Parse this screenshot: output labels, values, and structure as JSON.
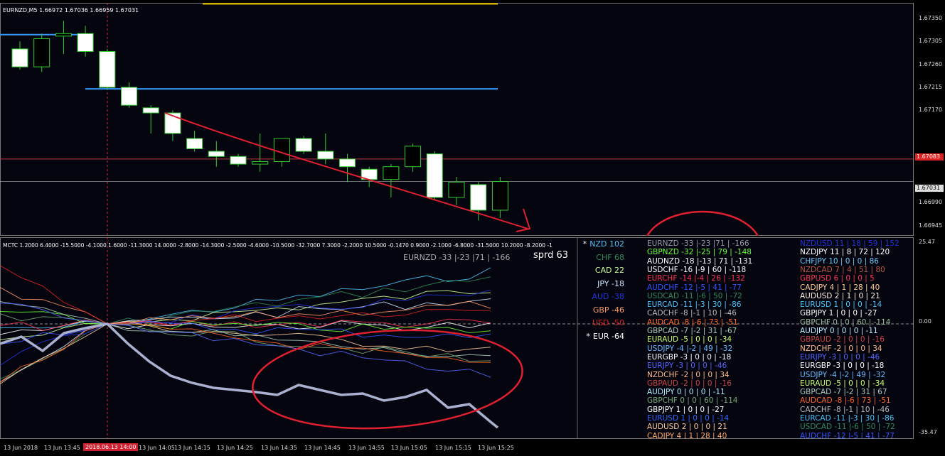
{
  "chart": {
    "title": "EURNZD,M5  1.66972 1.67036 1.66959 1.67031",
    "last_price_tag": "1.67031",
    "red_line_tag": "1.67083",
    "price_axis": [
      "1.67350",
      "1.67305",
      "1.67260",
      "1.67215",
      "1.67170",
      "1.67080",
      "1.66990",
      "1.66945"
    ],
    "candles": [
      {
        "o": 1.6729,
        "h": 1.67305,
        "l": 1.6725,
        "c": 1.67255
      },
      {
        "o": 1.67255,
        "h": 1.6732,
        "l": 1.67245,
        "c": 1.6731
      },
      {
        "o": 1.67315,
        "h": 1.67345,
        "l": 1.6728,
        "c": 1.6732
      },
      {
        "o": 1.6732,
        "h": 1.67335,
        "l": 1.67275,
        "c": 1.67285
      },
      {
        "o": 1.67285,
        "h": 1.6729,
        "l": 1.6721,
        "c": 1.67215
      },
      {
        "o": 1.67215,
        "h": 1.67225,
        "l": 1.67175,
        "c": 1.6718
      },
      {
        "o": 1.67175,
        "h": 1.6718,
        "l": 1.67125,
        "c": 1.67165
      },
      {
        "o": 1.67165,
        "h": 1.6717,
        "l": 1.6711,
        "c": 1.67125
      },
      {
        "o": 1.67115,
        "h": 1.6713,
        "l": 1.6709,
        "c": 1.67095
      },
      {
        "o": 1.6709,
        "h": 1.6711,
        "l": 1.6706,
        "c": 1.6708
      },
      {
        "o": 1.6708,
        "h": 1.67085,
        "l": 1.6706,
        "c": 1.67065
      },
      {
        "o": 1.67065,
        "h": 1.67125,
        "l": 1.6705,
        "c": 1.6707
      },
      {
        "o": 1.6707,
        "h": 1.67115,
        "l": 1.6706,
        "c": 1.67115
      },
      {
        "o": 1.67115,
        "h": 1.6712,
        "l": 1.67085,
        "c": 1.6709
      },
      {
        "o": 1.6709,
        "h": 1.67125,
        "l": 1.67065,
        "c": 1.67075
      },
      {
        "o": 1.67075,
        "h": 1.67085,
        "l": 1.6703,
        "c": 1.6706
      },
      {
        "o": 1.67055,
        "h": 1.6706,
        "l": 1.6702,
        "c": 1.67035
      },
      {
        "o": 1.67035,
        "h": 1.67065,
        "l": 1.67,
        "c": 1.6706
      },
      {
        "o": 1.6706,
        "h": 1.67105,
        "l": 1.6705,
        "c": 1.671
      },
      {
        "o": 1.67085,
        "h": 1.6709,
        "l": 1.66995,
        "c": 1.67
      },
      {
        "o": 1.67,
        "h": 1.6704,
        "l": 1.66985,
        "c": 1.6703
      },
      {
        "o": 1.67025,
        "h": 1.6703,
        "l": 1.66955,
        "c": 1.66975
      },
      {
        "o": 1.66975,
        "h": 1.6704,
        "l": 1.6696,
        "c": 1.67031
      }
    ]
  },
  "indicator": {
    "title": "MCTC  1.2000 6.4000 -15.5000 -4.1000 1.6000 -11.3000 14.0000 -2.8000 -14.3000 -2.5000 -4.6000 -10.5000 -32.7000 7.3000 -2.2000 10.5000 -0.1470 0.9000 -2.1000 -6.8000 -31.5000 10.2000 -8.2000 -1",
    "pair_readout": "EURNZD -33 |-23 |71 | -166",
    "spread": "sprd 63",
    "axis_top": "25.47",
    "axis_mid": "0.00",
    "axis_bottom": "-35.47"
  },
  "currencies": [
    {
      "mark": "*",
      "name": "NZD",
      "value": "102",
      "color": "#4fc3f7"
    },
    {
      "mark": "",
      "name": "CHF",
      "value": "68",
      "color": "#2e8b57"
    },
    {
      "mark": "",
      "name": "CAD",
      "value": "22",
      "color": "#ccff99"
    },
    {
      "mark": "",
      "name": "JPY",
      "value": "-18",
      "color": "#cfe8ff"
    },
    {
      "mark": "",
      "name": "AUD",
      "value": "-38",
      "color": "#2233dd"
    },
    {
      "mark": "",
      "name": "GBP",
      "value": "-46",
      "color": "#ff9966"
    },
    {
      "mark": "",
      "name": "USD",
      "value": "-50",
      "color": "#dd2222"
    },
    {
      "mark": "*",
      "name": "EUR",
      "value": "-64",
      "color": "#ffffff"
    }
  ],
  "pairs_left": [
    {
      "text": "EURNZD -33 |-23 |71 | -166",
      "color": "#9999aa"
    },
    {
      "text": "GBPNZD -32 |-25 | 79 | -148",
      "color": "#66ff33"
    },
    {
      "text": "AUDNZD -18 |-13 | 71 | -131",
      "color": "#ffffff"
    },
    {
      "text": "USDCHF -16 |-9 | 60 | -118",
      "color": "#ffffff"
    },
    {
      "text": "EURCHF -14 |-4 | 26 | -132",
      "color": "#ff3355"
    },
    {
      "text": "AUDCHF -12 |-5 | 41 | -77",
      "color": "#3355ff"
    },
    {
      "text": "USDCAD -11 |-6 | 50 | -72",
      "color": "#2e8b57"
    },
    {
      "text": "EURCAD -11 |-3 | 30 | -86",
      "color": "#4fc3f7"
    },
    {
      "text": "CADCHF -8 |-1 | 10 | -46",
      "color": "#bbbbbb"
    },
    {
      "text": "AUDCAD -8 |-6 | 73 | -51",
      "color": "#ff6622"
    },
    {
      "text": "GBPCAD -7 |-2 | 31 | -67",
      "color": "#aaccbb"
    },
    {
      "text": "EURAUD -5 | 0 | 0 | -34",
      "color": "#ccff66"
    },
    {
      "text": "USDJPY -4 |-2 | 49 | -32",
      "color": "#66bbff"
    },
    {
      "text": "EURGBP -3 | 0 | 0 | -18",
      "color": "#ffffff"
    },
    {
      "text": "EURJPY -3 | 0 | 0 | -46",
      "color": "#5566ff"
    },
    {
      "text": "NZDCHF -2 | 0 | 0 | 34",
      "color": "#ffbb88"
    },
    {
      "text": "GBPAUD -2 | 0 | 0 | -16",
      "color": "#cc4444"
    },
    {
      "text": "AUDJPY 0 | 0 | 0 | -11",
      "color": "#aaeeff"
    },
    {
      "text": "GBPCHF 0 | 0 | 60 | -114",
      "color": "#77aa77"
    },
    {
      "text": "GBPJPY 1 | 0 | 0 | -27",
      "color": "#ffffff"
    },
    {
      "text": "EURUSD 1 | 0 | 0 | -14",
      "color": "#3366ff"
    },
    {
      "text": "AUDUSD 2 | 0 | 0 | 21",
      "color": "#ffcc99"
    },
    {
      "text": "CADJPY 4 | 1 | 28 | 40",
      "color": "#ffaa66"
    }
  ],
  "pairs_right": [
    {
      "text": "NZDUSD 11 | 18 | 59 | 152",
      "color": "#2233dd"
    },
    {
      "text": "NZDJPY 11 | 8 | 72 | 120",
      "color": "#ffffff"
    },
    {
      "text": "CHFJPY 10 | 0 | 0 | 86",
      "color": "#66ccff"
    },
    {
      "text": "NZDCAD 7 | 4 | 51 | 80",
      "color": "#bb5544"
    },
    {
      "text": "GBPUSD 6 | 0 | 0 | 5",
      "color": "#ff3355"
    },
    {
      "text": "CADJPY 4 | 1 | 28 | 40",
      "color": "#ffcc99"
    },
    {
      "text": "AUDUSD 2 | 1 | 0 | 21",
      "color": "#ffeedd"
    },
    {
      "text": "EURUSD 1 | 0 | 0 | -14",
      "color": "#4fc3f7"
    },
    {
      "text": "GBPJPY 1 | 0 | 0 | -27",
      "color": "#ffffff"
    },
    {
      "text": "GBPCHF 0 | 0 | 60 | -114",
      "color": "#99bb99"
    },
    {
      "text": "AUDJPY 0 | 0 | 0 | -11",
      "color": "#bbeeff"
    },
    {
      "text": "GBPAUD -2 | 0 | 0 | -16",
      "color": "#cc4444"
    },
    {
      "text": "NZDCHF -2 | 0 | 0 | 34",
      "color": "#ffbb88"
    },
    {
      "text": "EURJPY -3 | 0 | 0 | -46",
      "color": "#5566ff"
    },
    {
      "text": "EURGBP -3 | 0 | 0 | -18",
      "color": "#ffffff"
    },
    {
      "text": "USDJPY -4 |-2 | 49 | -32",
      "color": "#66bbff"
    },
    {
      "text": "EURAUD -5 | 0 | 0 | -34",
      "color": "#ccff66"
    },
    {
      "text": "GBPCAD -7 |-2 | 31 | 67",
      "color": "#aaccbb"
    },
    {
      "text": "AUDCAD -8 |-6 | 73 | -51",
      "color": "#ff6622"
    },
    {
      "text": "CADCHF -8 |-1 | 10 | -46",
      "color": "#bbbbbb"
    },
    {
      "text": "EURCAD -11 |-3 | 30 | -86",
      "color": "#4fc3f7"
    },
    {
      "text": "USDCAD -11 |-6 | 50 | -72",
      "color": "#2e8b57"
    },
    {
      "text": "AUDCHF -12 |-5 | 41 | -77",
      "color": "#3355ff"
    }
  ],
  "time_axis": [
    "13 Jun 2018",
    "13 Jun 13:45",
    "13 Jun 14:05",
    "13 Jun 14:15",
    "13 Jun 14:25",
    "13 Jun 14:35",
    "13 Jun 14:45",
    "13 Jun 14:55",
    "13 Jun 15:05",
    "13 Jun 15:15",
    "13 Jun 15:25"
  ],
  "crosshair_time": "2018.06.13 14:00"
}
